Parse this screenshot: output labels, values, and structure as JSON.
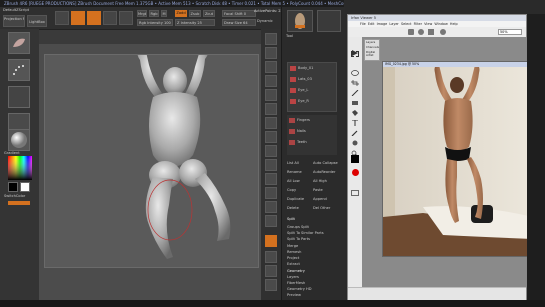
{
  "zbrush": {
    "title_bar": "ZBrush 4R6 [RUEGE PRODUCTIONS]    ZBrush Document    Free Mem 1.375GB • Active Mem 513 • Scratch Disk 48 • Timer 0.021 • Total Mem 5 • PolyCount 0.044 • MeshCount 1",
    "menu_btn": "Menus",
    "default_script": "DefaultZScript",
    "top_labels": {
      "projection_master": "Projection Master",
      "lightbox": "LightBox",
      "mrgb": "Mrgb",
      "rgb": "Rgb",
      "m": "M",
      "zadd": "Zadd",
      "zsub": "Zsub",
      "zcut": "Zcut",
      "focal_shift": "Focal Shift 0",
      "z_intensity": "Z Intensity 25",
      "draw_size": "Draw Size 64",
      "dynamic": "Dynamic",
      "rgb_intensity": "Rgb Intensity 100",
      "active_points": "ActivePoints: 22,164",
      "total_points": "TotalPoints: 74,024"
    },
    "left_labels": {
      "switch_color": "SwitchColor",
      "gradient": "Gradient"
    },
    "right_shelf": [
      "BPR",
      "SPix 3",
      "Scroll",
      "Zoom",
      "Actual",
      "AAHalf",
      "Persp",
      "Floor",
      "Local",
      "L.Sym",
      "Frame",
      "Move",
      "Scale",
      "Rotate",
      "PolyF",
      "Transp",
      "Ghost",
      "Solo",
      "Xpose"
    ],
    "tray": {
      "header": "Tool",
      "load": "Load Tool",
      "save": "Save As",
      "subtool_title": "SubTool",
      "subtools": [
        "Body_01",
        "Lats_03",
        "Eye_L",
        "Eye_R",
        "Fingers",
        "Nails",
        "Teeth"
      ],
      "list_all": "List All",
      "auto_collapse": "Auto Collapse",
      "rename": "Rename",
      "auto_reorder": "AutoReorder",
      "all_low": "All Low",
      "all_high": "All High",
      "copy": "Copy",
      "paste": "Paste",
      "duplicate": "Duplicate",
      "append": "Append",
      "insert": "Insert",
      "delete": "Delete",
      "del_other": "Del Other",
      "del_all": "Del All",
      "split": "Split",
      "groups_split": "Groups Split",
      "split_hidden": "Split To Similar Parts",
      "split_unmasked": "Split To Parts",
      "merge": "Merge",
      "remesh": "Remesh",
      "project": "Project",
      "extract": "Extract",
      "geometry": "Geometry",
      "layers": "Layers",
      "fibermesh": "FiberMesh",
      "geometry_hd": "Geometry HD",
      "preview": "Preview"
    }
  },
  "viewer": {
    "title": "Irfan Viewer 5",
    "menu": [
      "File",
      "Edit",
      "Image",
      "Layer",
      "Select",
      "Filter",
      "View",
      "Window",
      "Help"
    ],
    "doc_title": "IMG_0234.jpg @ 50%",
    "side_labels": [
      "Layers",
      "Channels",
      "Digital Artist"
    ],
    "zoom_value": "50%"
  },
  "colors": {
    "accent_orange": "#d4711f",
    "zbrush_bg": "#3a3a3a",
    "canvas_bg": "#5a5a5a"
  }
}
